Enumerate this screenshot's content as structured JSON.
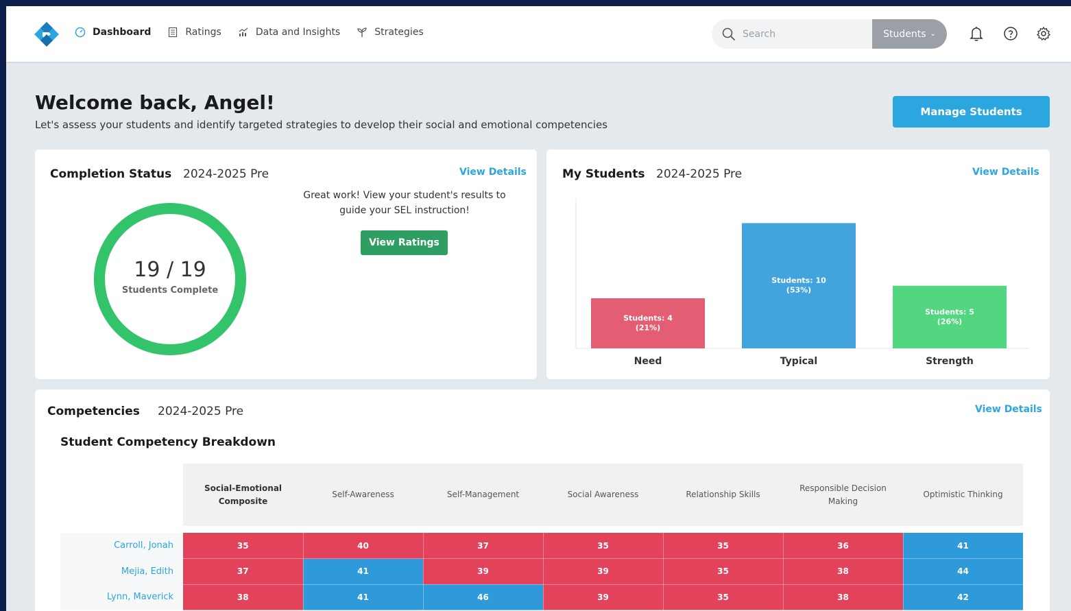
{
  "nav": {
    "items": [
      {
        "label": "Dashboard",
        "icon": "dashboard-gauge-icon"
      },
      {
        "label": "Ratings",
        "icon": "list-icon"
      },
      {
        "label": "Data and Insights",
        "icon": "chart-icon"
      },
      {
        "label": "Strategies",
        "icon": "sprout-icon"
      }
    ],
    "search_placeholder": "Search",
    "search_scope": "Students"
  },
  "welcome": {
    "title": "Welcome back, Angel!",
    "subtitle": "Let's assess your students and identify targeted strategies to develop their social and emotional competencies",
    "manage_button": "Manage Students"
  },
  "completion": {
    "title": "Completion Status",
    "period": "2024-2025 Pre",
    "view_details": "View Details",
    "count": "19 / 19",
    "count_label": "Students Complete",
    "completed": 19,
    "total": 19,
    "message": "Great work! View your student's results to guide your SEL instruction!",
    "button": "View Ratings",
    "ring_color": "#33c46b"
  },
  "my_students": {
    "title": "My Students",
    "period": "2024-2025 Pre",
    "view_details": "View Details"
  },
  "chart_data": {
    "type": "bar",
    "categories": [
      "Need",
      "Typical",
      "Strength"
    ],
    "values": [
      4,
      10,
      5
    ],
    "data_labels": [
      [
        "Students: 4",
        "(21%)"
      ],
      [
        "Students: 10",
        "(53%)"
      ],
      [
        "Students: 5",
        "(26%)"
      ]
    ],
    "colors": [
      "#e35e72",
      "#42a3dd",
      "#52d67f"
    ],
    "ylim": [
      0,
      11.5
    ]
  },
  "competencies": {
    "title": "Competencies",
    "period": "2024-2025 Pre",
    "view_details": "View Details",
    "subtitle": "Student Competency Breakdown",
    "headers": [
      "Social-Emotional Composite",
      "Self-Awareness",
      "Self-Management",
      "Social Awareness",
      "Relationship Skills",
      "Responsible Decision Making",
      "Optimistic Thinking"
    ],
    "rows": [
      {
        "name": "Carroll, Jonah",
        "values": [
          35,
          40,
          37,
          35,
          35,
          36,
          41
        ],
        "levels": [
          "need",
          "need",
          "need",
          "need",
          "need",
          "need",
          "typical"
        ]
      },
      {
        "name": "Mejia, Edith",
        "values": [
          37,
          41,
          39,
          39,
          35,
          38,
          44
        ],
        "levels": [
          "need",
          "typical",
          "need",
          "need",
          "need",
          "need",
          "typical"
        ]
      },
      {
        "name": "Lynn, Maverick",
        "values": [
          38,
          41,
          46,
          39,
          35,
          38,
          42
        ],
        "levels": [
          "need",
          "typical",
          "typical",
          "need",
          "need",
          "need",
          "typical"
        ]
      }
    ]
  },
  "colors": {
    "accent": "#2ba6df",
    "need": "#e2435a",
    "typical": "#2f9ad9",
    "strength": "#52d67f"
  }
}
